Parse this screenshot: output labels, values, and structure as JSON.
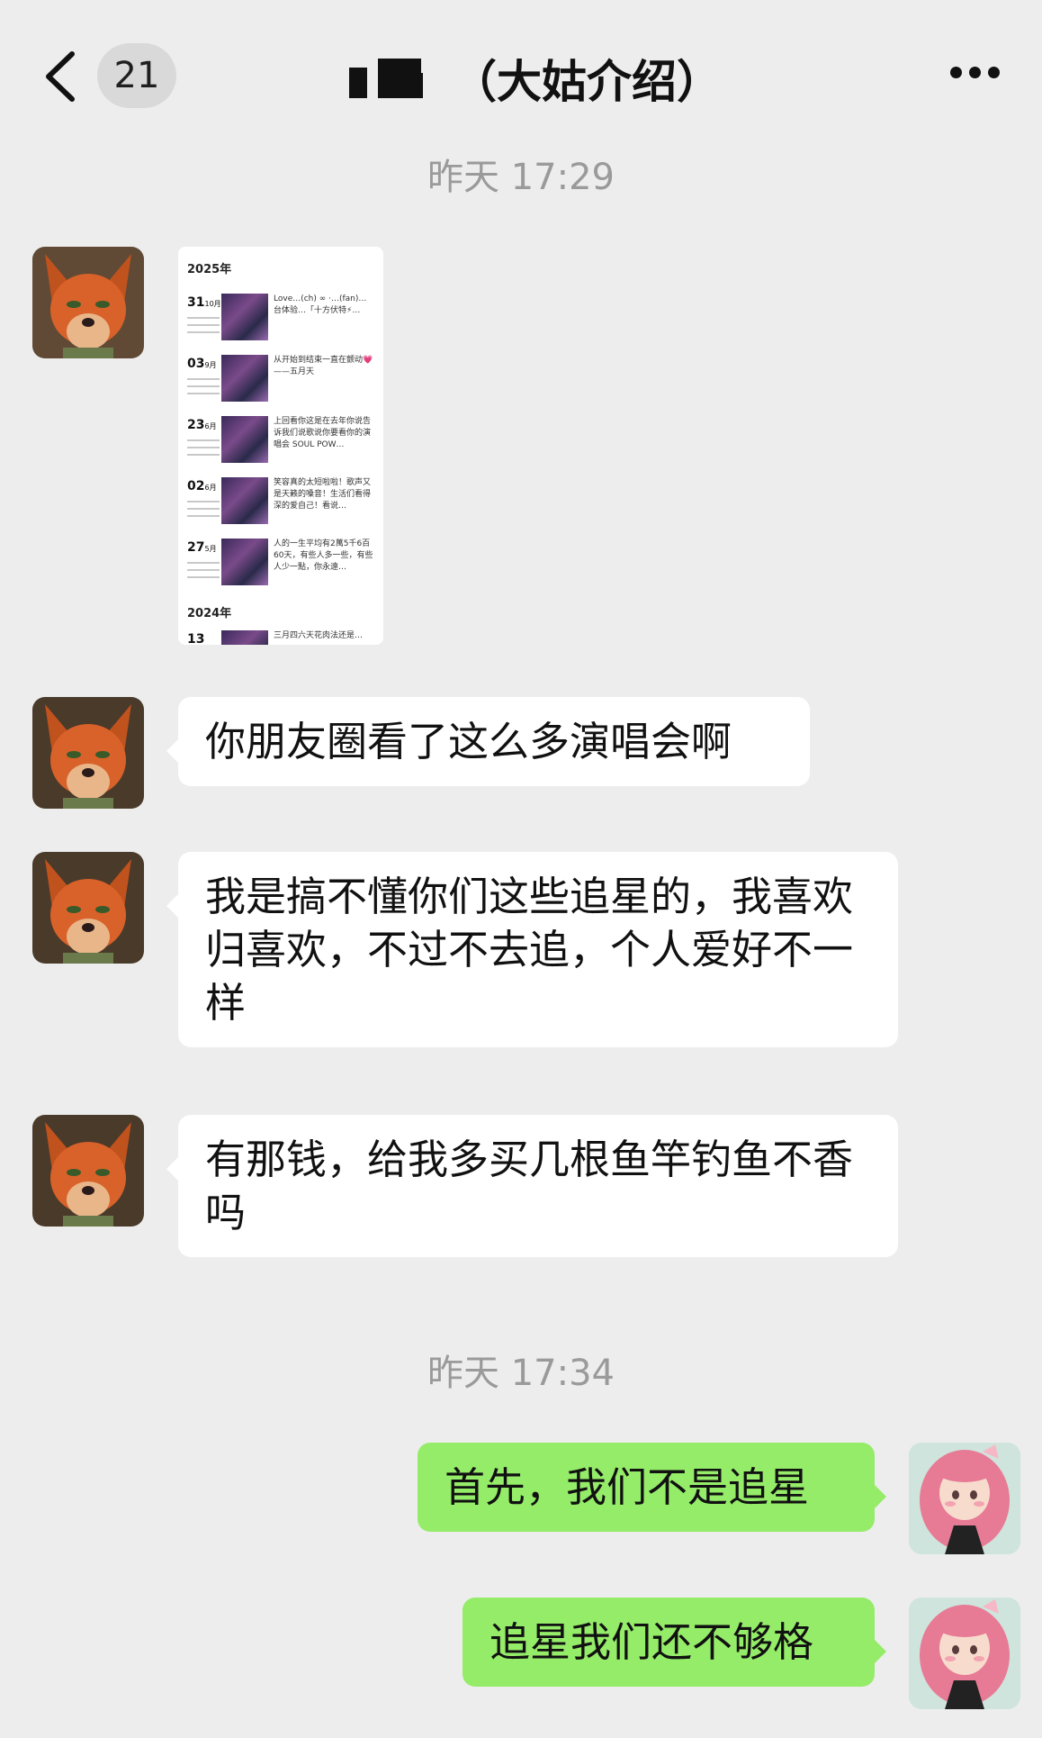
{
  "header": {
    "unread_count": "21",
    "title_suffix": "（大姑介绍）"
  },
  "timestamps": [
    "昨天 17:29",
    "昨天 17:34"
  ],
  "shared_image": {
    "years": [
      "2025年",
      "2024年"
    ],
    "entries": [
      {
        "day": "31",
        "month": "10月",
        "caption": "Love…(ch) ∞ ·…(fan)…台体验…「十方伏特⚡…"
      },
      {
        "day": "03",
        "month": "9月",
        "caption": "从开始到结束一直在颤动💗 ——五月天"
      },
      {
        "day": "23",
        "month": "6月",
        "caption": "上回看你这是在去年你说告诉我们说歌说你要看你的演唱会 SOUL POW…"
      },
      {
        "day": "02",
        "month": "6月",
        "caption": "笑容真的太短啦啦！歌声又是天籁的嗓音！生活们看得深的爱自己！看说…"
      },
      {
        "day": "27",
        "month": "5月",
        "caption": "人的一生平均有2萬5千6百60天，有些人多一些，有些人少一點，你永遠…"
      },
      {
        "day": "13",
        "month": "",
        "caption": "三月四六天花肉法还是…"
      }
    ]
  },
  "messages": [
    {
      "side": "left",
      "text": "你朋友圈看了这么多演唱会啊"
    },
    {
      "side": "left",
      "text": "我是搞不懂你们这些追星的，我喜欢归喜欢，不过不去追，个人爱好不一样"
    },
    {
      "side": "left",
      "text": "有那钱，给我多买几根鱼竿钓鱼不香吗"
    },
    {
      "side": "right",
      "text": "首先，我们不是追星"
    },
    {
      "side": "right",
      "text": "追星我们还不够格"
    }
  ],
  "colors": {
    "background": "#ededed",
    "bubble_other": "#ffffff",
    "bubble_self": "#95ec69",
    "timestamp": "#9a9a9a"
  },
  "icons": {
    "back": "chevron-left-icon",
    "more": "more-dots-icon",
    "contact_avatar": "fox-cartoon-avatar",
    "self_avatar": "pink-hair-girl-avatar"
  }
}
